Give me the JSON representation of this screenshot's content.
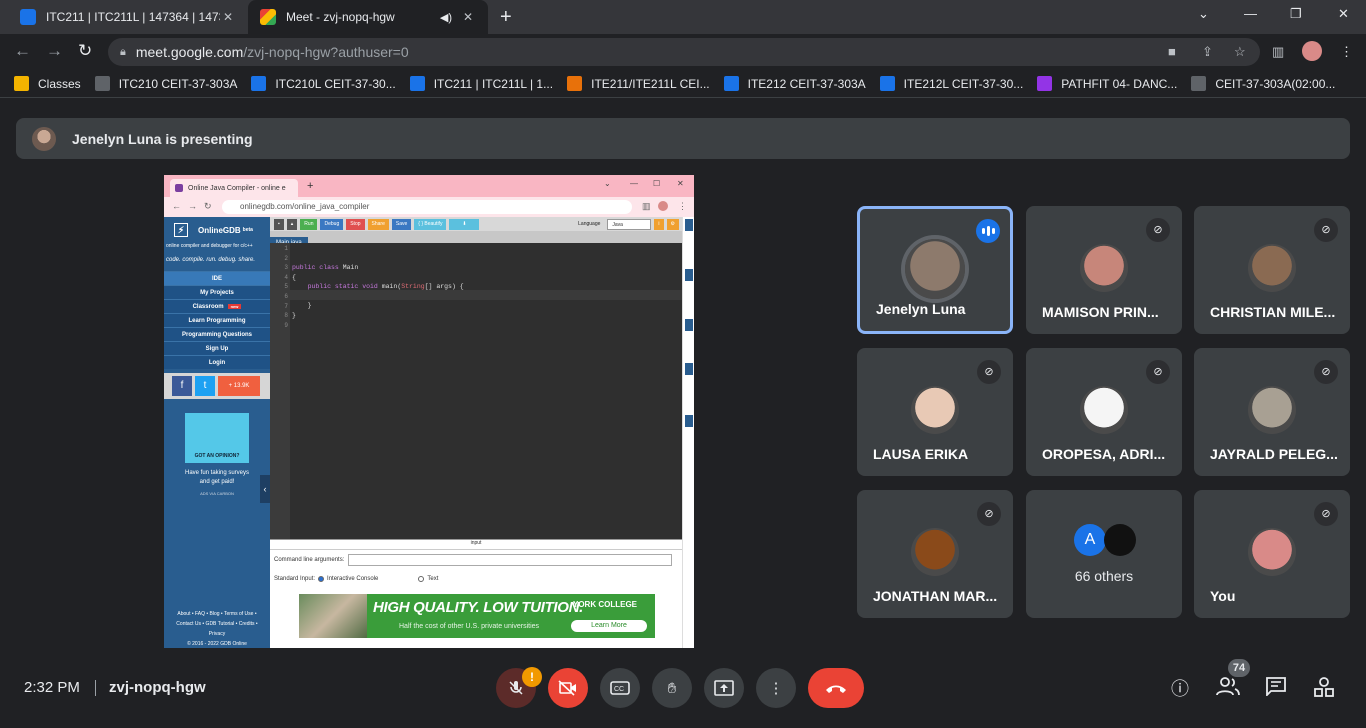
{
  "browser": {
    "tabs": [
      {
        "title": "ITC211 | ITC211L | 147364 | 1473"
      },
      {
        "title": "Meet - zvj-nopq-hgw"
      }
    ],
    "url_host": "meet.google.com",
    "url_path": "/zvj-nopq-hgw?authuser=0",
    "bookmarks": [
      {
        "label": "Classes",
        "color": "#f4b400"
      },
      {
        "label": "ITC210 CEIT-37-303A",
        "color": "#5f6368"
      },
      {
        "label": "ITC210L CEIT-37-30...",
        "color": "#1a73e8"
      },
      {
        "label": "ITC211 | ITC211L | 1...",
        "color": "#1a73e8"
      },
      {
        "label": "ITE211/ITE211L CEI...",
        "color": "#e8710a"
      },
      {
        "label": "ITE212 CEIT-37-303A",
        "color": "#1a73e8"
      },
      {
        "label": "ITE212L CEIT-37-30...",
        "color": "#1a73e8"
      },
      {
        "label": "PATHFIT 04- DANC...",
        "color": "#9334e6"
      },
      {
        "label": "CEIT-37-303A(02:00...",
        "color": "#5f6368"
      }
    ]
  },
  "meet": {
    "presenting_text": "Jenelyn Luna is presenting",
    "time": "2:32 PM",
    "meeting_code": "zvj-nopq-hgw",
    "participant_count": "74",
    "others_label": "66 others",
    "others_initial": "A",
    "participants": [
      {
        "name": "Jenelyn Luna",
        "avatar_color": "#8d7a6c"
      },
      {
        "name": "MAMISON PRIN...",
        "avatar_color": "#c7867a"
      },
      {
        "name": "CHRISTIAN MILE...",
        "avatar_color": "#8a6a52"
      },
      {
        "name": "LAUSA ERIKA",
        "avatar_color": "#e8c9b5"
      },
      {
        "name": "OROPESA, ADRI...",
        "avatar_color": "#f5f5f5"
      },
      {
        "name": "JAYRALD PELEG...",
        "avatar_color": "#a8a093"
      },
      {
        "name": "JONATHAN MAR...",
        "avatar_color": "#8a4a1a"
      },
      {
        "name": "You",
        "avatar_color": "#d98a88"
      }
    ],
    "accent": "#8ab4f8",
    "danger": "#ea4335"
  },
  "presentation": {
    "tab_title": "Online Java Compiler - online e",
    "url": "onlinegdb.com/online_java_compiler",
    "logo": "OnlineGDB",
    "logo_sup": "beta",
    "tagline": "online compiler and debugger for c/c++",
    "words": "code. compile. run. debug. share.",
    "menu": [
      "IDE",
      "My Projects",
      "Classroom",
      "Learn Programming",
      "Programming Questions",
      "Sign Up",
      "Login"
    ],
    "classroom_badge": "new",
    "share_count": "13.9K",
    "ad_title": "GOT AN OPINION?",
    "ad_line1": "Have fun taking surveys",
    "ad_line2": "and get paid!",
    "ad_by": "ADS VIA CARBON",
    "footer1": "About • FAQ • Blog • Terms of Use •",
    "footer2": "Contact Us • GDB Tutorial • Credits •",
    "footer3": "Privacy",
    "footer4": "© 2016 - 2022 GDB Online",
    "buttons": [
      "Run",
      "Debug",
      "Stop",
      "Share",
      "Save",
      "{ } Beautify"
    ],
    "language_label": "Language",
    "language_value": "Java",
    "file_name": "Main.java",
    "line_numbers": [
      "1",
      "2",
      "3",
      "4",
      "5",
      "6",
      "7",
      "8",
      "9"
    ],
    "code_line3a": "public class ",
    "code_line3b": "Main",
    "code_line4": "{",
    "code_line5a": "    public static void ",
    "code_line5b": "main(",
    "code_line5c": "String",
    "code_line5d": "[] args) {",
    "code_line7": "    }",
    "code_line8": "}",
    "input_header": "input",
    "cmd_label": "Command line arguments:",
    "stdin_label": "Standard Input:",
    "interactive_label": "Interactive Console",
    "text_label": "Text",
    "banner_head": "HIGH QUALITY. LOW TUITION.",
    "banner_sub": "Half the cost of other U.S. private universities",
    "banner_college": "YORK COLLEGE",
    "banner_cta": "Learn More"
  }
}
